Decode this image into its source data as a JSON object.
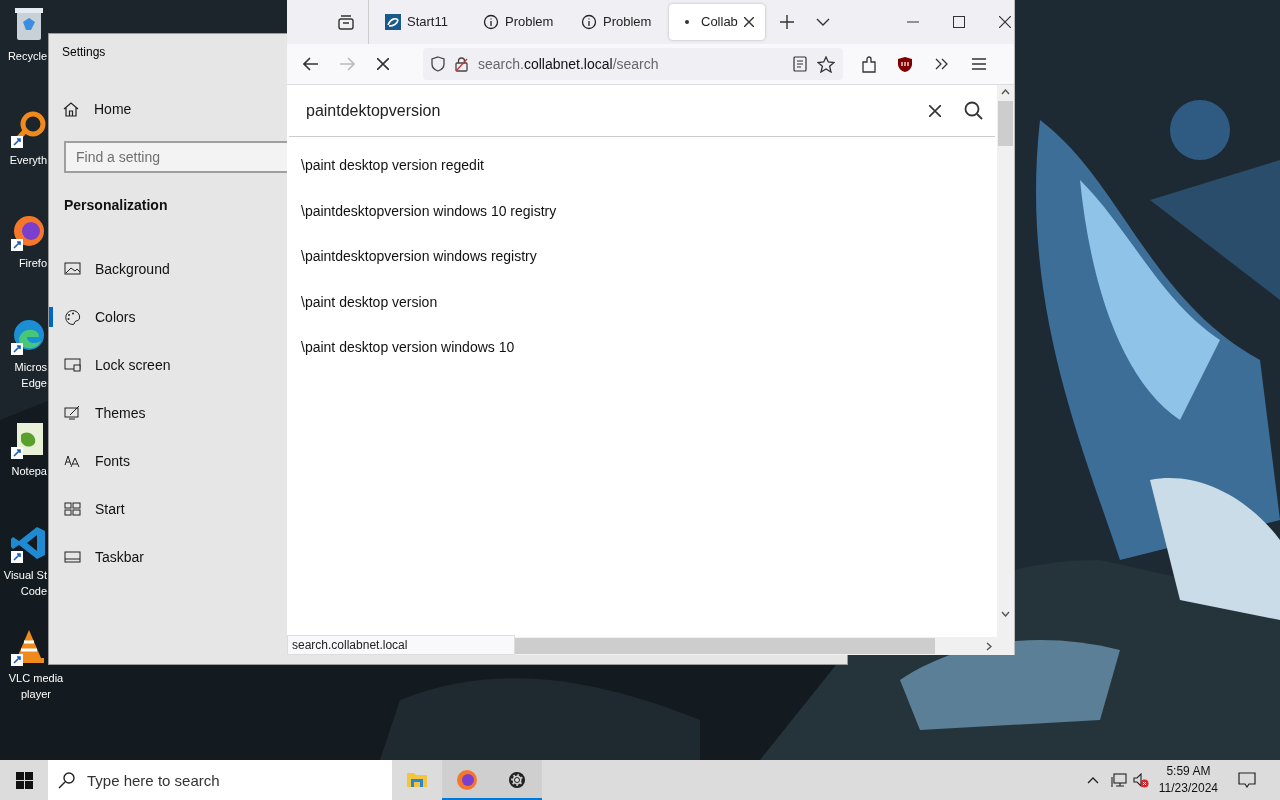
{
  "desktop": {
    "icons": [
      {
        "kind": "recycle",
        "lines": [
          "Recycle"
        ]
      },
      {
        "kind": "search",
        "lines": [
          "Everyth"
        ]
      },
      {
        "kind": "firefox",
        "lines": [
          "Firefo"
        ]
      },
      {
        "kind": "edge",
        "lines": [
          "Micros",
          "Edge"
        ]
      },
      {
        "kind": "notepad",
        "lines": [
          "Notepa"
        ]
      },
      {
        "kind": "vscode",
        "lines": [
          "Visual St",
          "Code"
        ]
      },
      {
        "kind": "vlc",
        "lines": [
          "VLC media",
          "player"
        ]
      }
    ]
  },
  "settings": {
    "title": "Settings",
    "home": "Home",
    "search": {
      "placeholder": "Find a setting"
    },
    "section": "Personalization",
    "items": [
      {
        "kind": "background",
        "label": "Background",
        "selected": false
      },
      {
        "kind": "colors",
        "label": "Colors",
        "selected": true
      },
      {
        "kind": "lock",
        "label": "Lock screen",
        "selected": false
      },
      {
        "kind": "themes",
        "label": "Themes",
        "selected": false
      },
      {
        "kind": "fonts",
        "label": "Fonts",
        "selected": false
      },
      {
        "kind": "start",
        "label": "Start",
        "selected": false
      },
      {
        "kind": "taskbar",
        "label": "Taskbar",
        "selected": false
      }
    ]
  },
  "browser": {
    "tabs": [
      {
        "kind": "start11",
        "label": "Start11",
        "selected": false,
        "loading": false
      },
      {
        "kind": "info",
        "label": "Problem",
        "selected": false,
        "loading": false
      },
      {
        "kind": "info",
        "label": "Problem",
        "selected": false,
        "loading": false
      },
      {
        "kind": "page",
        "label": "Collab",
        "selected": true,
        "loading": true
      }
    ],
    "url": {
      "prefix": "search.",
      "domain": "collabnet.local",
      "path": "/search"
    },
    "search": {
      "value": "paintdektopversion"
    },
    "suggestions": [
      "\\paint desktop version regedit",
      "\\paintdesktopversion windows 10 registry",
      "\\paintdesktopversion windows registry",
      "\\paint desktop version",
      "\\paint desktop version windows 10"
    ],
    "status": "search.collabnet.local"
  },
  "taskbar": {
    "search": {
      "placeholder": "Type here to search"
    },
    "apps": [
      {
        "kind": "explorer",
        "active": false
      },
      {
        "kind": "firefox",
        "active": true
      },
      {
        "kind": "settings",
        "active": true
      }
    ],
    "time": "5:59 AM",
    "date": "11/23/2024"
  }
}
